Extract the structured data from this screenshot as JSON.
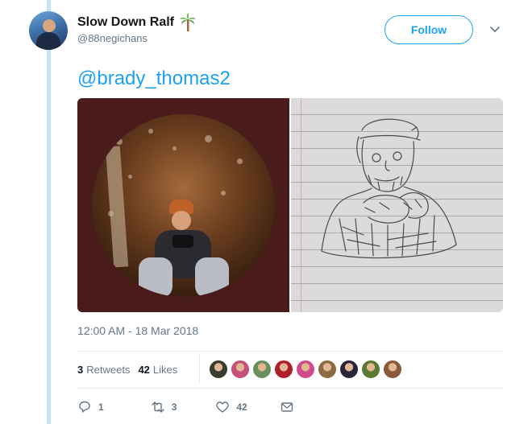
{
  "user": {
    "display_name": "Slow Down Ralf",
    "emoji_icon": "palm-tree-icon",
    "handle": "@88negichans",
    "follow_label": "Follow"
  },
  "tweet": {
    "text": "@brady_thomas2",
    "timestamp": "12:00 AM - 18 Mar 2018"
  },
  "stats": {
    "retweets_count": "3",
    "retweets_label": "Retweets",
    "likes_count": "42",
    "likes_label": "Likes"
  },
  "likers_colors": [
    "#3b3b2e",
    "#c4517a",
    "#6a8f5e",
    "#b0202a",
    "#d24a8e",
    "#8a6b42",
    "#2c2438",
    "#5b7a2f",
    "#8a5a3a"
  ],
  "actions": {
    "reply_count": "1",
    "retweet_count": "3",
    "like_count": "42"
  },
  "colors": {
    "accent": "#1da1f2",
    "secondary_text": "#657786",
    "thread_line": "#c4e4f7"
  }
}
